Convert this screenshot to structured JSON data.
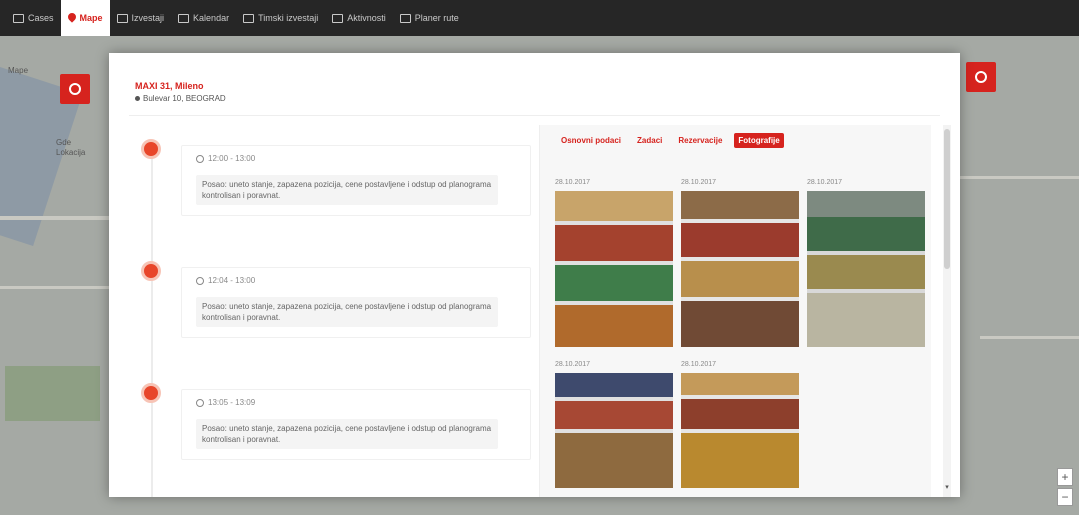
{
  "nav": {
    "items": [
      {
        "label": "Cases",
        "icon": "home-icon",
        "active": false
      },
      {
        "label": "Mape",
        "icon": "map-pin-icon",
        "active": true
      },
      {
        "label": "Izvestaji",
        "icon": "report-icon",
        "active": false
      },
      {
        "label": "Kalendar",
        "icon": "calendar-icon",
        "active": false
      },
      {
        "label": "Timski izvestaji",
        "icon": "team-icon",
        "active": false
      },
      {
        "label": "Aktivnosti",
        "icon": "monitor-icon",
        "active": false
      },
      {
        "label": "Planer rute",
        "icon": "planner-icon",
        "active": false
      }
    ]
  },
  "map": {
    "labels": [
      "Gde",
      "Lokacija",
      "Mape"
    ]
  },
  "modal": {
    "store_name": "MAXI 31, Mileno",
    "store_address": "Bulevar 10, BEOGRAD",
    "entries": [
      {
        "time": "12:00 - 13:00",
        "note": "Posao: uneto stanje, zapazena pozicija, cene postavljene i odstup od planograma kontrolisan i poravnat."
      },
      {
        "time": "12:04 - 13:00",
        "note": "Posao: uneto stanje, zapazena pozicija, cene postavljene i odstup od planograma kontrolisan i poravnat."
      },
      {
        "time": "13:05 - 13:09",
        "note": "Posao: uneto stanje, zapazena pozicija, cene postavljene i odstup od planograma kontrolisan i poravnat."
      }
    ],
    "tabs": [
      {
        "label": "Osnovni podaci",
        "active": false
      },
      {
        "label": "Zadaci",
        "active": false
      },
      {
        "label": "Rezervacije",
        "active": false
      },
      {
        "label": "Fotografije",
        "active": true
      }
    ],
    "photos": [
      {
        "date": "28.10.2017"
      },
      {
        "date": "28.10.2017"
      },
      {
        "date": "28.10.2017"
      },
      {
        "date": "28.10.2017"
      },
      {
        "date": "28.10.2017"
      }
    ]
  },
  "colors": {
    "accent": "#d6231e",
    "nav_bg": "#262626"
  }
}
